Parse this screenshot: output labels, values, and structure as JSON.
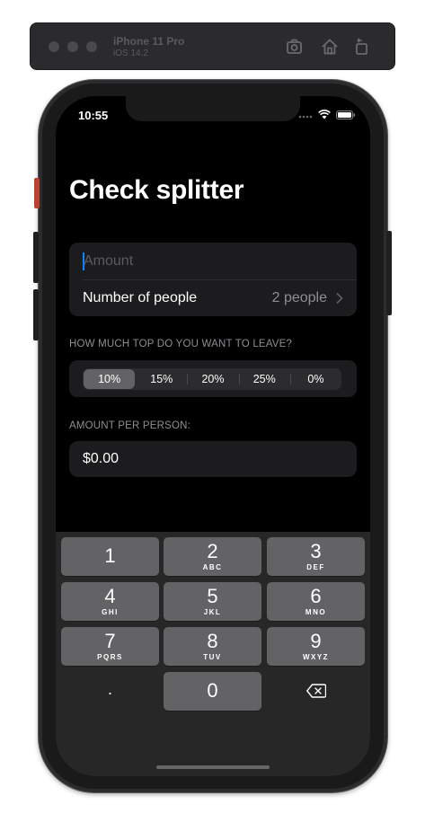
{
  "simulator": {
    "device": "iPhone 11 Pro",
    "os": "iOS 14.2"
  },
  "status_bar": {
    "time": "10:55"
  },
  "app": {
    "title": "Check splitter",
    "amount_placeholder": "Amount",
    "amount_value": "",
    "people_label": "Number of people",
    "people_value": "2 people",
    "tip_header": "HOW MUCH TOP DO YOU WANT TO LEAVE?",
    "tip_options": [
      "10%",
      "15%",
      "20%",
      "25%",
      "0%"
    ],
    "tip_selected": "10%",
    "per_person_header": "AMOUNT PER PERSON:",
    "per_person_value": "$0.00"
  },
  "keyboard": {
    "keys": [
      {
        "n": "1",
        "l": ""
      },
      {
        "n": "2",
        "l": "ABC"
      },
      {
        "n": "3",
        "l": "DEF"
      },
      {
        "n": "4",
        "l": "GHI"
      },
      {
        "n": "5",
        "l": "JKL"
      },
      {
        "n": "6",
        "l": "MNO"
      },
      {
        "n": "7",
        "l": "PQRS"
      },
      {
        "n": "8",
        "l": "TUV"
      },
      {
        "n": "9",
        "l": "WXYZ"
      },
      {
        "n": ".",
        "l": ""
      },
      {
        "n": "0",
        "l": ""
      },
      {
        "n": "delete-icon",
        "l": ""
      }
    ]
  },
  "colors": {
    "accent": "#0a84ff",
    "background": "#000000",
    "cell": "#1c1c1e",
    "key": "#636366"
  }
}
